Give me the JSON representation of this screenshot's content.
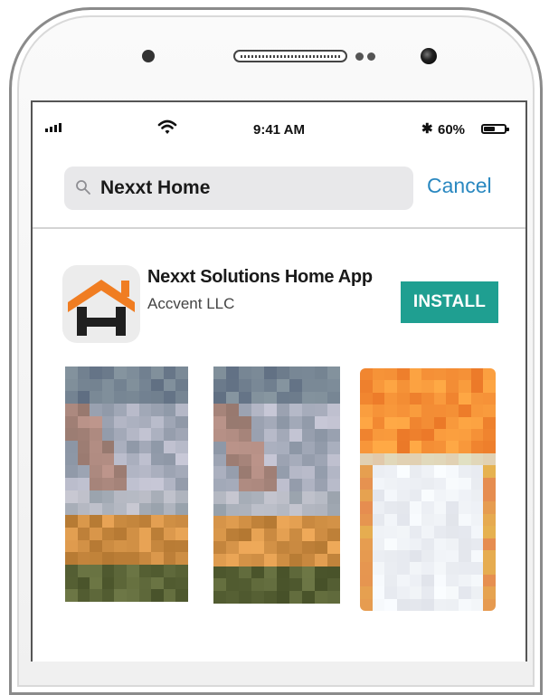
{
  "status_bar": {
    "time": "9:41 AM",
    "battery_pct": "60%",
    "battery_level": 0.6,
    "bluetooth_icon": "bluetooth-icon",
    "wifi_icon": "wifi-icon",
    "signal_icon": "cellular-signal-icon"
  },
  "search": {
    "query": "Nexxt Home",
    "icon": "search-icon",
    "cancel_label": "Cancel"
  },
  "result": {
    "app_name": "Nexxt Solutions Home App",
    "developer": "Accvent LLC",
    "install_label": "INSTALL",
    "icon": "house-h-logo-icon"
  },
  "screenshots": [
    {
      "name": "screenshot-1"
    },
    {
      "name": "screenshot-2"
    },
    {
      "name": "screenshot-3"
    }
  ],
  "colors": {
    "install_bg": "#1f9f91",
    "cancel": "#2a88c0",
    "logo_orange": "#f07d22",
    "logo_dark": "#1f1f1f"
  }
}
